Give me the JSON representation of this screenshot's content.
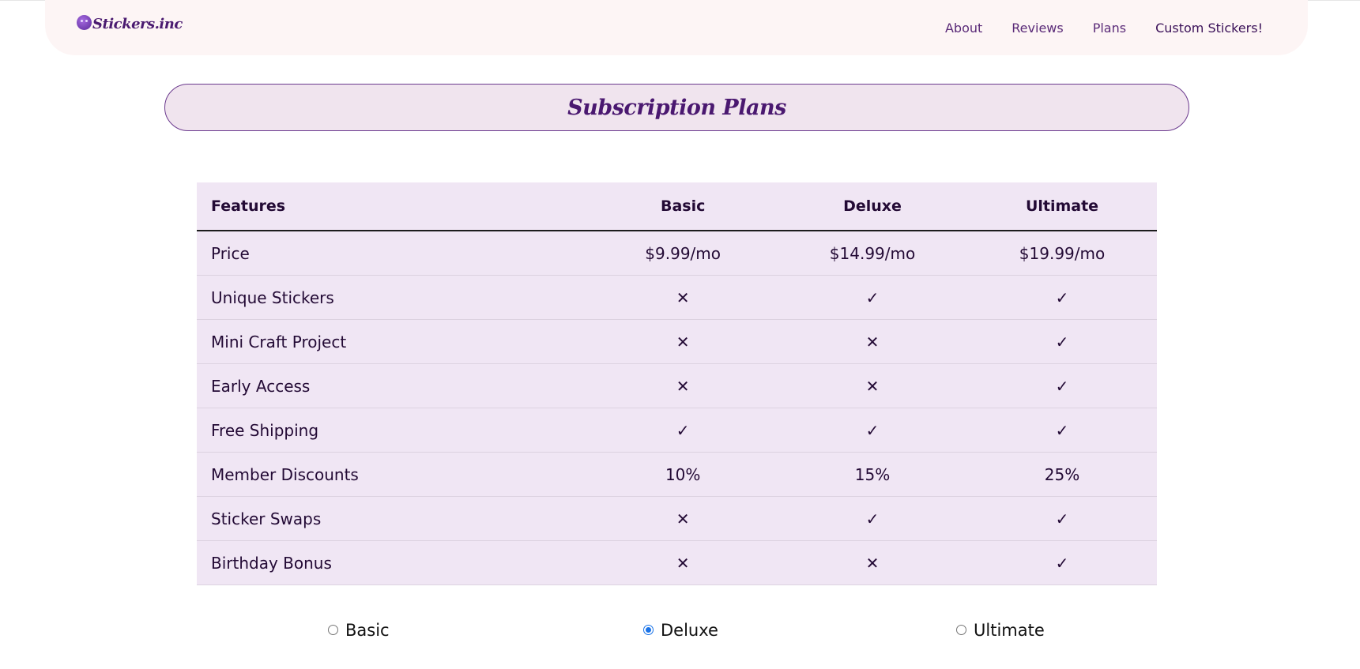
{
  "navbar": {
    "logo_text": "Stickers.inc",
    "links": [
      "About",
      "Reviews",
      "Plans",
      "Custom Stickers!"
    ]
  },
  "page_title": "Subscription Plans",
  "table": {
    "headers": [
      "Features",
      "Basic",
      "Deluxe",
      "Ultimate"
    ],
    "rows": [
      {
        "feature": "Price",
        "basic": "$9.99/mo",
        "deluxe": "$14.99/mo",
        "ultimate": "$19.99/mo"
      },
      {
        "feature": "Unique Stickers",
        "basic": "✕",
        "deluxe": "✓",
        "ultimate": "✓"
      },
      {
        "feature": "Mini Craft Project",
        "basic": "✕",
        "deluxe": "✕",
        "ultimate": "✓"
      },
      {
        "feature": "Early Access",
        "basic": "✕",
        "deluxe": "✕",
        "ultimate": "✓"
      },
      {
        "feature": "Free Shipping",
        "basic": "✓",
        "deluxe": "✓",
        "ultimate": "✓"
      },
      {
        "feature": "Member Discounts",
        "basic": "10%",
        "deluxe": "15%",
        "ultimate": "25%"
      },
      {
        "feature": "Sticker Swaps",
        "basic": "✕",
        "deluxe": "✓",
        "ultimate": "✓"
      },
      {
        "feature": "Birthday Bonus",
        "basic": "✕",
        "deluxe": "✕",
        "ultimate": "✓"
      }
    ]
  },
  "plan_options": [
    {
      "label": "Basic",
      "checked": false
    },
    {
      "label": "Deluxe",
      "checked": true
    },
    {
      "label": "Ultimate",
      "checked": false
    }
  ],
  "colors": {
    "navbar_bg": "#fdf5f5",
    "title_bg": "#f0e4ee",
    "title_border": "#6b3a8e",
    "table_bg": "#f0e6f4",
    "accent_text": "#4a1870",
    "radio_checked": "#1a73e8"
  },
  "icons": {
    "logo": "purple-face-icon",
    "yes": "check-icon",
    "no": "cross-icon"
  }
}
